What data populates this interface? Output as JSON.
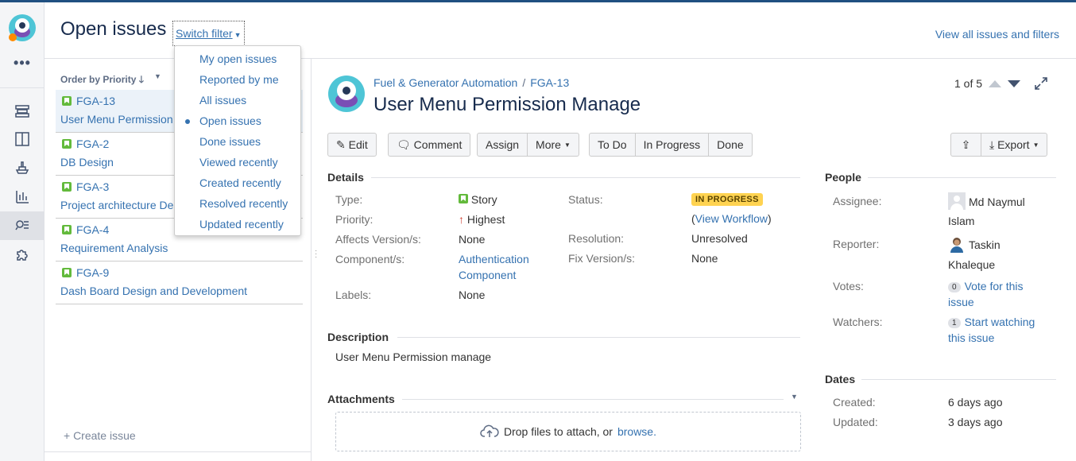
{
  "header": {
    "title": "Open issues",
    "switch_filter": "Switch filter",
    "view_all": "View all issues and filters"
  },
  "filter_menu": {
    "items": [
      {
        "label": "My open issues",
        "selected": false
      },
      {
        "label": "Reported by me",
        "selected": false
      },
      {
        "label": "All issues",
        "selected": false
      },
      {
        "label": "Open issues",
        "selected": true
      },
      {
        "label": "Done issues",
        "selected": false
      },
      {
        "label": "Viewed recently",
        "selected": false
      },
      {
        "label": "Created recently",
        "selected": false
      },
      {
        "label": "Resolved recently",
        "selected": false
      },
      {
        "label": "Updated recently",
        "selected": false
      }
    ]
  },
  "list": {
    "order_by": "Order by Priority",
    "create_issue": "+ Create issue",
    "issues": [
      {
        "key": "FGA-13",
        "summary": "User Menu Permission Manage"
      },
      {
        "key": "FGA-2",
        "summary": "DB Design"
      },
      {
        "key": "FGA-3",
        "summary": "Project architecture Design"
      },
      {
        "key": "FGA-4",
        "summary": "Requirement Analysis"
      },
      {
        "key": "FGA-9",
        "summary": "Dash Board Design and Development"
      }
    ]
  },
  "issue": {
    "project": "Fuel & Generator Automation",
    "key": "FGA-13",
    "title": "User Menu Permission Manage",
    "pager": "1 of 5"
  },
  "actions": {
    "edit": "Edit",
    "comment": "Comment",
    "assign": "Assign",
    "more": "More",
    "todo": "To Do",
    "in_progress": "In Progress",
    "done": "Done",
    "export": "Export"
  },
  "details": {
    "heading": "Details",
    "type_label": "Type:",
    "type_value": "Story",
    "priority_label": "Priority:",
    "priority_value": "Highest",
    "affects_label": "Affects Version/s:",
    "affects_value": "None",
    "component_label": "Component/s:",
    "component_value_1": "Authentication",
    "component_value_2": "Component",
    "labels_label": "Labels:",
    "labels_value": "None",
    "status_label": "Status:",
    "status_value": "IN PROGRESS",
    "view_workflow": "View Workflow",
    "resolution_label": "Resolution:",
    "resolution_value": "Unresolved",
    "fix_label": "Fix Version/s:",
    "fix_value": "None"
  },
  "description": {
    "heading": "Description",
    "text": "User Menu Permission manage"
  },
  "attachments": {
    "heading": "Attachments",
    "drop_text": "Drop files to attach, or",
    "browse": "browse."
  },
  "people": {
    "heading": "People",
    "assignee_label": "Assignee:",
    "assignee_1": "Md Naymul",
    "assignee_2": "Islam",
    "reporter_label": "Reporter:",
    "reporter_1": "Taskin",
    "reporter_2": "Khaleque",
    "votes_label": "Votes:",
    "votes_count": "0",
    "votes_link_1": "Vote for this",
    "votes_link_2": "issue",
    "watchers_label": "Watchers:",
    "watchers_count": "1",
    "watchers_link_1": "Start watching",
    "watchers_link_2": "this issue"
  },
  "dates": {
    "heading": "Dates",
    "created_label": "Created:",
    "created_value": "6 days ago",
    "updated_label": "Updated:",
    "updated_value": "3 days ago"
  },
  "colors": {
    "link": "#3572b0",
    "status_badge": "#ffd351",
    "story": "#63ba3c",
    "priority_highest": "#d04437"
  }
}
